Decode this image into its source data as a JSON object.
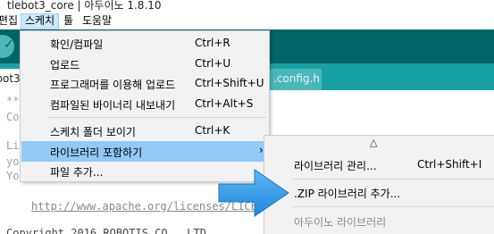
{
  "window": {
    "title": "tlebot3_core | 아두이노 1.8.10"
  },
  "menubar": [
    {
      "label": "편집"
    },
    {
      "label": "스케치",
      "active": true
    },
    {
      "label": "툴"
    },
    {
      "label": "도움말"
    }
  ],
  "tabs": {
    "current": "ebot3",
    "other": ".config.h"
  },
  "editor": {
    "lines": [
      "****",
      "Co",
      "Li",
      "yo",
      "Yo"
    ],
    "link": "http://www.apache.org/licenses/LICE",
    "last": "Copyright 2016 ROBOTIS CO., LTD."
  },
  "sketch_menu": {
    "items": [
      {
        "label": "확인/컴파일",
        "shortcut": "Ctrl+R"
      },
      {
        "label": "업로드",
        "shortcut": "Ctrl+U"
      },
      {
        "label": "프로그래머를 이용해 업로드",
        "shortcut": "Ctrl+Shift+U"
      },
      {
        "label": "컴파일된 바이너리 내보내기",
        "shortcut": "Ctrl+Alt+S"
      },
      {
        "label": "스케치 폴더 보이기",
        "shortcut": "Ctrl+K"
      },
      {
        "label": "라이브러리 포함하기",
        "shortcut": "",
        "highlighted": true
      },
      {
        "label": "파일 추가...",
        "shortcut": ""
      }
    ],
    "submenu_arrow": "›"
  },
  "library_submenu": {
    "scroll_up": "△",
    "items": [
      {
        "label": "라이브러리 관리...",
        "shortcut": "Ctrl+Shift+I"
      },
      {
        "label": ".ZIP 라이브러리 추가...",
        "shortcut": ""
      },
      {
        "label": "아두이노 라이브러리",
        "shortcut": "",
        "disabled": true
      }
    ]
  },
  "colors": {
    "toolbar": "#006468",
    "tabstrip": "#17a1a5",
    "menu_highlight": "#91c9f7",
    "arrow": "#2f9ae8"
  }
}
